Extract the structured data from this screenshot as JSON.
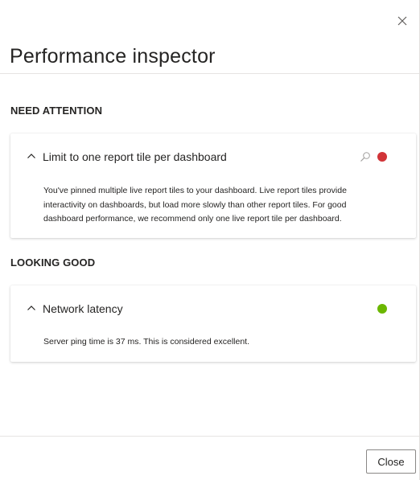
{
  "dialog": {
    "title": "Performance inspector",
    "close_icon": "close-icon",
    "close_button_label": "Close"
  },
  "sections": {
    "need_attention": {
      "heading": "NEED ATTENTION",
      "card": {
        "title": "Limit to one report tile per dashboard",
        "description": "You've pinned multiple live report tiles to your dashboard. Live report tiles provide interactivity on dashboards, but load more slowly than other report tiles. For good dashboard performance, we recommend only one live report tile per dashboard.",
        "chevron_icon": "chevron-up-icon",
        "action_icon": "search-icon",
        "status_color": "#d13438"
      }
    },
    "looking_good": {
      "heading": "LOOKING GOOD",
      "card": {
        "title": "Network latency",
        "description": "Server ping time is 37 ms. This is considered excellent.",
        "chevron_icon": "chevron-up-icon",
        "status_color": "#6bb700"
      }
    }
  }
}
